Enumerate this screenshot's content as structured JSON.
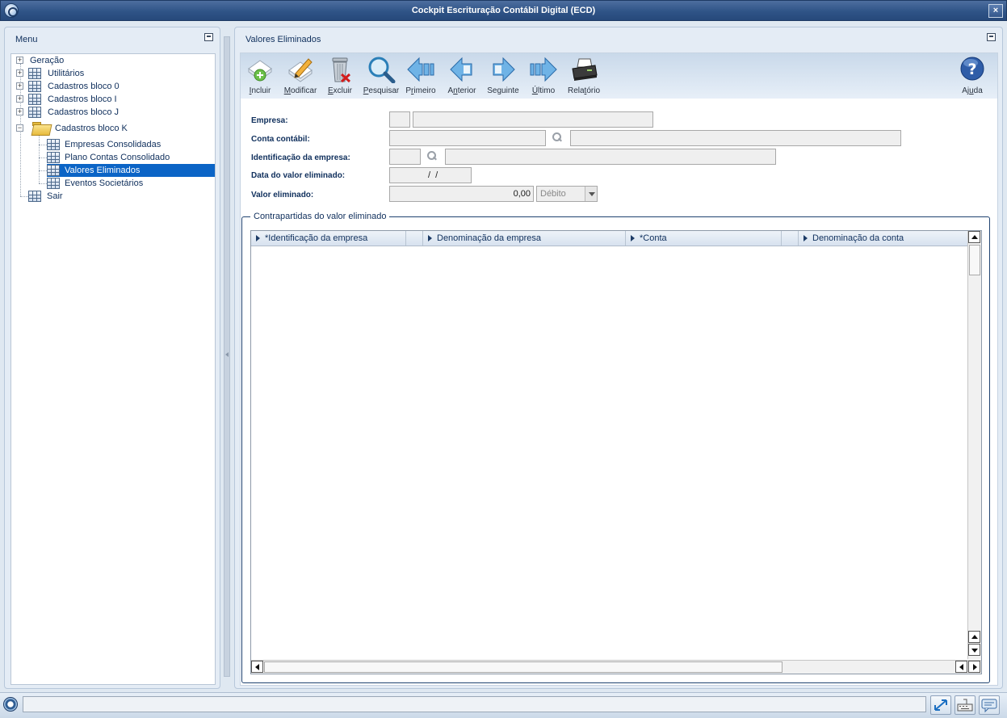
{
  "window": {
    "title": "Cockpit Escrituração Contábil Digital (ECD)",
    "close_label": "×"
  },
  "menu": {
    "title": "Menu",
    "items": [
      {
        "label": "Geração"
      },
      {
        "label": "Utilitários"
      },
      {
        "label": "Cadastros bloco 0"
      },
      {
        "label": "Cadastros bloco I"
      },
      {
        "label": "Cadastros bloco J"
      },
      {
        "label": "Cadastros bloco K"
      },
      {
        "label": "Empresas Consolidadas"
      },
      {
        "label": "Plano Contas Consolidado"
      },
      {
        "label": "Valores Eliminados"
      },
      {
        "label": "Eventos Societários"
      },
      {
        "label": "Sair"
      }
    ],
    "selected": "Valores Eliminados"
  },
  "main": {
    "title": "Valores Eliminados",
    "toolbar": {
      "incluir": {
        "underlined": "I",
        "rest": "ncluir"
      },
      "modificar": {
        "underlined": "M",
        "rest": "odificar"
      },
      "excluir": {
        "underlined": "E",
        "rest": "xcluir"
      },
      "pesquisar": {
        "underlined": "P",
        "rest": "esquisar"
      },
      "primeiro": {
        "pre": "P",
        "underlined": "r",
        "rest": "imeiro"
      },
      "anterior": {
        "pre": "A",
        "underlined": "n",
        "rest": "terior"
      },
      "seguinte": {
        "pre": "Se",
        "underlined": "g",
        "rest": "uinte"
      },
      "ultimo": {
        "underlined": "Ú",
        "rest": "ltimo"
      },
      "relatorio": {
        "pre": "Rela",
        "underlined": "t",
        "rest": "ório"
      },
      "ajuda": {
        "pre": "Aj",
        "underlined": "u",
        "rest": "da"
      }
    },
    "form": {
      "empresa_label": "Empresa:",
      "conta_contabil_label": "Conta contábil:",
      "identificacao_label": "Identificação da empresa:",
      "data_label": "Data do valor eliminado:",
      "data_value": "  /  /",
      "valor_label": "Valor eliminado:",
      "valor_value": "0,00",
      "tipo_selected": "Débito"
    },
    "group": {
      "title": "Contrapartidas do valor eliminado",
      "columns": [
        "*Identificação da empresa",
        "",
        "Denominação da empresa",
        "*Conta",
        "",
        "Denominação da conta"
      ]
    }
  },
  "icons": {
    "incluir": "add-document-icon",
    "modificar": "edit-document-icon",
    "excluir": "trash-icon",
    "pesquisar": "search-icon",
    "primeiro": "first-arrow-icon",
    "anterior": "previous-arrow-icon",
    "seguinte": "next-arrow-icon",
    "ultimo": "last-arrow-icon",
    "relatorio": "printer-icon",
    "ajuda": "help-icon"
  },
  "colors": {
    "selection": "#0b64c6",
    "title_bar": "#2f5487",
    "label_text": "#0f2f5c"
  }
}
